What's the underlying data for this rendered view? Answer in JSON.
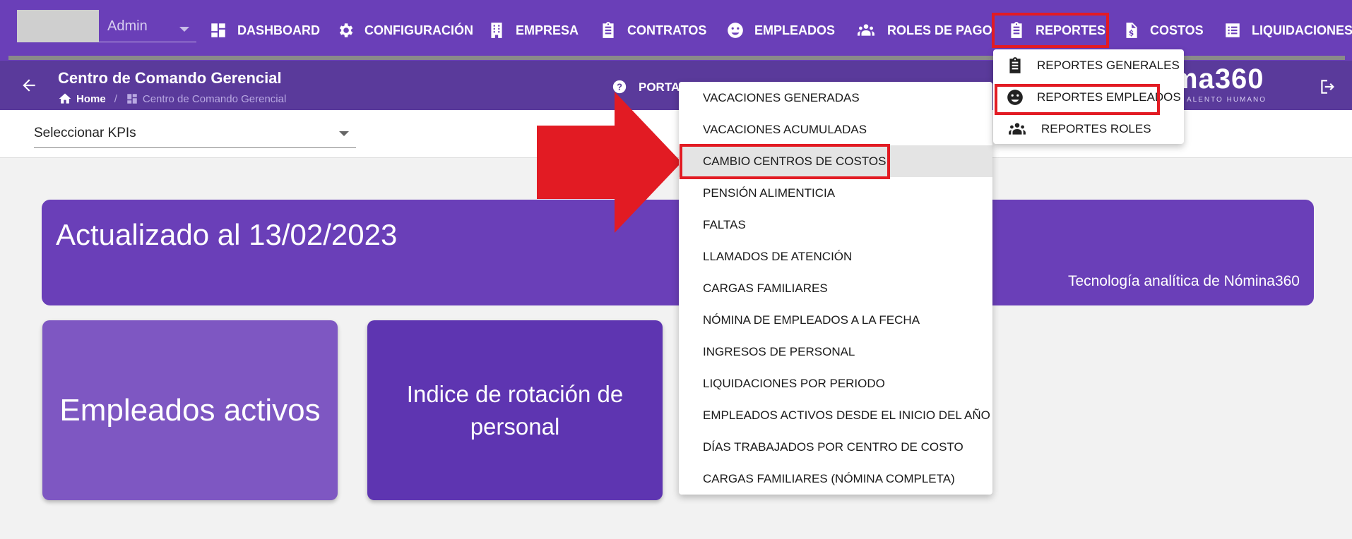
{
  "topnav": {
    "user_name": "Admin",
    "items": [
      {
        "label": "DASHBOARD",
        "icon": "dashboard-icon"
      },
      {
        "label": "CONFIGURACIÓN",
        "icon": "gear-icon"
      },
      {
        "label": "EMPRESA",
        "icon": "building-icon"
      },
      {
        "label": "CONTRATOS",
        "icon": "clipboard-icon"
      },
      {
        "label": "EMPLEADOS",
        "icon": "face-icon"
      },
      {
        "label": "ROLES DE PAGO",
        "icon": "people-icon"
      },
      {
        "label": "REPORTES",
        "icon": "clipboard-icon"
      },
      {
        "label": "COSTOS",
        "icon": "dollar-document-icon"
      },
      {
        "label": "LIQUIDACIONES",
        "icon": "list-icon"
      }
    ]
  },
  "subheader": {
    "title": "Centro de Comando Gerencial",
    "breadcrumb": {
      "home": "Home",
      "current": "Centro de Comando Gerencial"
    },
    "portal_label": "PORTA",
    "logo_text": "ma360",
    "logo_sub": "ALENTO HUMANO"
  },
  "kpi": {
    "placeholder": "Seleccionar KPIs"
  },
  "banner": {
    "title": "Actualizado al 13/02/2023",
    "footer": "Tecnología analítica de Nómina360"
  },
  "cards": {
    "employees": "Empleados activos",
    "rotation": "Indice de rotación de personal"
  },
  "reports_menu": {
    "items": [
      {
        "label": "REPORTES GENERALES",
        "icon": "clipboard-icon"
      },
      {
        "label": "REPORTES EMPLEADOS",
        "icon": "face-icon"
      },
      {
        "label": "REPORTES ROLES",
        "icon": "people-icon"
      }
    ]
  },
  "employee_reports_menu": {
    "items": [
      "VACACIONES GENERADAS",
      "VACACIONES ACUMULADAS",
      "CAMBIO CENTROS DE COSTOS",
      "PENSIÓN ALIMENTICIA",
      "FALTAS",
      "LLAMADOS DE ATENCIÓN",
      "CARGAS FAMILIARES",
      "NÓMINA DE EMPLEADOS A LA FECHA",
      "INGRESOS DE PERSONAL",
      "LIQUIDACIONES POR PERIODO",
      "EMPLEADOS ACTIVOS DESDE EL INICIO DEL AÑO",
      "DÍAS TRABAJADOS POR CENTRO DE COSTO",
      "CARGAS FAMILIARES (NÓMINA COMPLETA)"
    ]
  },
  "colors": {
    "nav_bg": "#6a3fb8",
    "subheader_bg": "#5a3a9b",
    "banner_bg": "#6a3fb8",
    "card_employees": "#7e57c2",
    "card_rotation": "#5e35b1",
    "highlight": "#e21b23"
  }
}
